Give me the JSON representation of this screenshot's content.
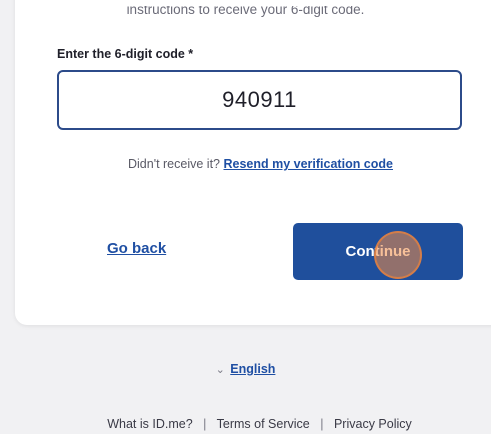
{
  "card": {
    "instructions": "instructions to receive your 6-digit code.",
    "code_label": "Enter the 6-digit code *",
    "code_value": "940911",
    "resend_prefix": "Didn't receive it?",
    "resend_link": "Resend my verification code",
    "go_back_label": "Go back",
    "continue_label": "Continue"
  },
  "language": {
    "chevron_icon": "chevron-down-icon",
    "label": "English"
  },
  "footer": {
    "links": [
      "What is ID.me?",
      "Terms of Service",
      "Privacy Policy"
    ],
    "separator": "|"
  },
  "colors": {
    "accent": "#1f4f9c",
    "link": "#1f4fa3",
    "background": "#f1f1f3",
    "click_indicator": "#f08c46"
  }
}
